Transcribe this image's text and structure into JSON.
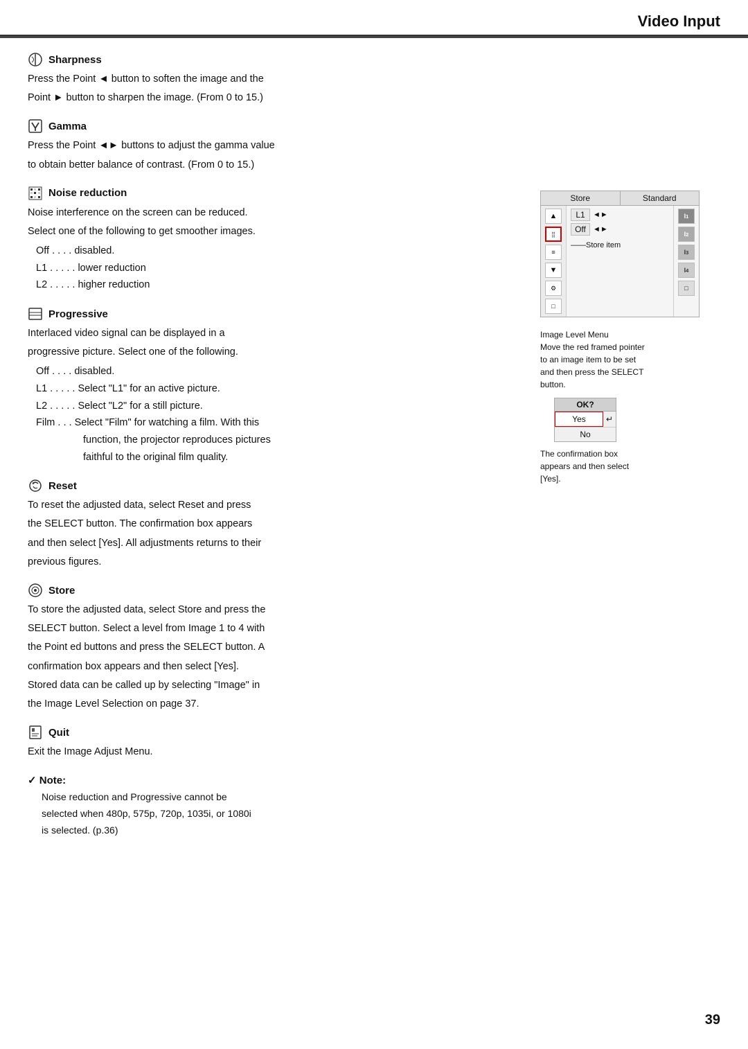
{
  "header": {
    "title": "Video Input",
    "page_number": "39"
  },
  "sections": {
    "sharpness": {
      "heading": "Sharpness",
      "body1": "Press the Point ◄ button to soften the image and the",
      "body2": "Point ► button to sharpen the image. (From 0 to 15.)"
    },
    "gamma": {
      "heading": "Gamma",
      "body1": "Press the Point ◄► buttons to adjust the gamma value",
      "body2": "to obtain better balance of contrast. (From 0 to 15.)"
    },
    "noise": {
      "heading": "Noise  reduction",
      "body1": "Noise interference on the screen can be reduced.",
      "body2": "Select one of the following to get smoother images.",
      "items": [
        {
          "label": "Off . . . .",
          "desc": "disabled."
        },
        {
          "label": "L1 . . . . .",
          "desc": "lower reduction"
        },
        {
          "label": "L2 . . . . .",
          "desc": "higher reduction"
        }
      ]
    },
    "progressive": {
      "heading": "Progressive",
      "body1": "Interlaced video signal can be displayed in a",
      "body2": "progressive picture.  Select one of the following.",
      "items": [
        {
          "label": "Off . . . .",
          "desc": "disabled."
        },
        {
          "label": "L1 . . . . .",
          "desc": "Select \"L1\" for an active picture."
        },
        {
          "label": "L2 . . . . .",
          "desc": "Select \"L2\" for a still picture."
        },
        {
          "label": "Film . . .",
          "desc": "Select \"Film\" for watching a film.  With this"
        }
      ],
      "film_indent1": "function, the projector reproduces pictures",
      "film_indent2": "faithful to the original film quality."
    },
    "reset": {
      "heading": "Reset",
      "body1": "To reset the adjusted data, select Reset and press",
      "body2": "the SELECT button.  The confirmation box appears",
      "body3": "and then select [Yes].  All adjustments returns to their",
      "body4": "previous figures."
    },
    "store": {
      "heading": "Store",
      "body1": "To store the adjusted data, select Store and press the",
      "body2": "SELECT button.  Select a level from Image 1 to 4 with",
      "body3": "the Point ed buttons and press the SELECT button.  A",
      "body4": "confirmation box appears and then select [Yes].",
      "body5": "Stored data can be called up by selecting \"Image\" in",
      "body6": "the Image Level Selection on page 37."
    },
    "quit": {
      "heading": "Quit",
      "body1": "Exit the Image Adjust Menu."
    },
    "note": {
      "heading": "✓ Note:",
      "body1": "Noise reduction and Progressive cannot be",
      "body2": "selected when 480p, 575p, 720p, 1035i, or 1080i",
      "body3": "is selected. (p.36)"
    }
  },
  "diagram": {
    "header_left": "Store",
    "header_right": "Standard",
    "rows": [
      {
        "label": "L1",
        "arrow": "◄►",
        "icon": "I1"
      },
      {
        "label": "Off",
        "arrow": "◄►",
        "icon": "I2"
      }
    ],
    "icons_left": [
      "▲",
      "⣿",
      "≡",
      "▼",
      "⚙",
      "□"
    ],
    "icons_right": [
      "I1",
      "I2",
      "I3",
      "I4",
      "□"
    ],
    "store_item_label": "——Store item",
    "caption1": "Image Level Menu",
    "caption2": "Move the red framed pointer",
    "caption3": "to an image item to be set",
    "caption4": "and then press the SELECT",
    "caption5": "button."
  },
  "confirmation": {
    "ok_label": "OK?",
    "yes_label": "Yes",
    "no_label": "No",
    "caption1": "The confirmation box",
    "caption2": "appears and then select",
    "caption3": "[Yes]."
  }
}
